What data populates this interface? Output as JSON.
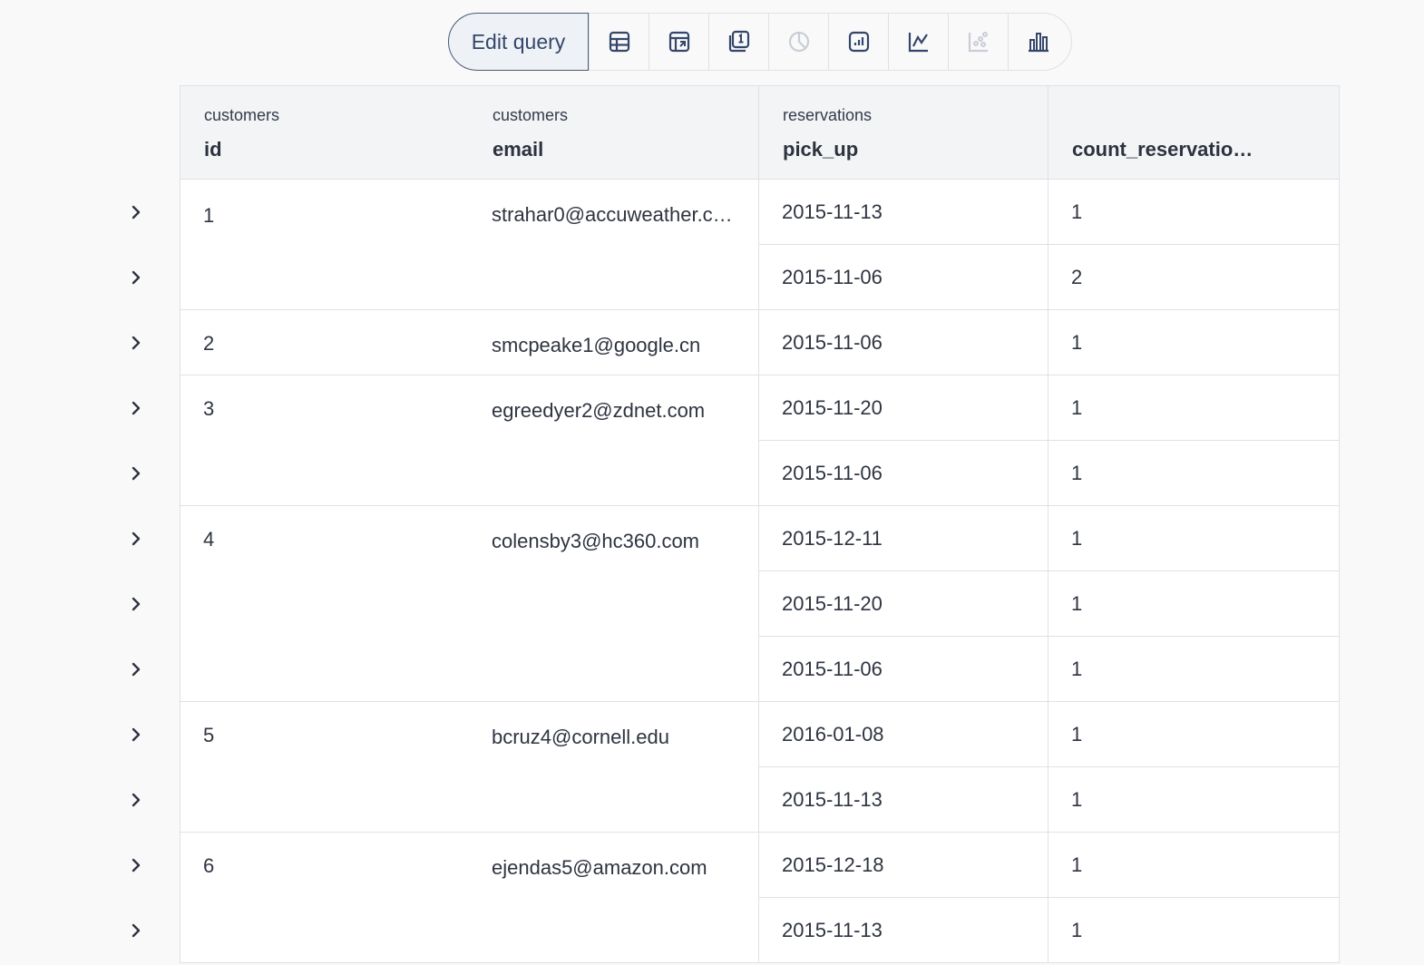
{
  "toolbar": {
    "edit_label": "Edit query",
    "icons": [
      "table-icon",
      "pivot-table-icon",
      "number-icon",
      "pie-chart-icon",
      "combo-chart-icon",
      "line-chart-icon",
      "scatter-chart-icon",
      "bar-chart-icon"
    ],
    "disabled_icons": [
      "pie-chart-icon",
      "scatter-chart-icon"
    ]
  },
  "table": {
    "columns": [
      {
        "table": "customers",
        "name": "id"
      },
      {
        "table": "customers",
        "name": "email"
      },
      {
        "table": "reservations",
        "name": "pick_up"
      },
      {
        "table": "",
        "name": "count_reservatio…"
      }
    ],
    "groups": [
      {
        "id": "1",
        "email": "strahar0@accuweather.c…",
        "rows": [
          {
            "pick_up": "2015-11-13",
            "count": "1"
          },
          {
            "pick_up": "2015-11-06",
            "count": "2"
          }
        ]
      },
      {
        "id": "2",
        "email": "smcpeake1@google.cn",
        "rows": [
          {
            "pick_up": "2015-11-06",
            "count": "1"
          }
        ]
      },
      {
        "id": "3",
        "email": "egreedyer2@zdnet.com",
        "rows": [
          {
            "pick_up": "2015-11-20",
            "count": "1"
          },
          {
            "pick_up": "2015-11-06",
            "count": "1"
          }
        ]
      },
      {
        "id": "4",
        "email": "colensby3@hc360.com",
        "rows": [
          {
            "pick_up": "2015-12-11",
            "count": "1"
          },
          {
            "pick_up": "2015-11-20",
            "count": "1"
          },
          {
            "pick_up": "2015-11-06",
            "count": "1"
          }
        ]
      },
      {
        "id": "5",
        "email": "bcruz4@cornell.edu",
        "rows": [
          {
            "pick_up": "2016-01-08",
            "count": "1"
          },
          {
            "pick_up": "2015-11-13",
            "count": "1"
          }
        ]
      },
      {
        "id": "6",
        "email": "ejendas5@amazon.com",
        "rows": [
          {
            "pick_up": "2015-12-18",
            "count": "1"
          },
          {
            "pick_up": "2015-11-13",
            "count": "1"
          }
        ]
      }
    ]
  },
  "colors": {
    "accent": "#34476a",
    "border": "#dfe1e5",
    "header_bg": "#f3f4f6"
  }
}
